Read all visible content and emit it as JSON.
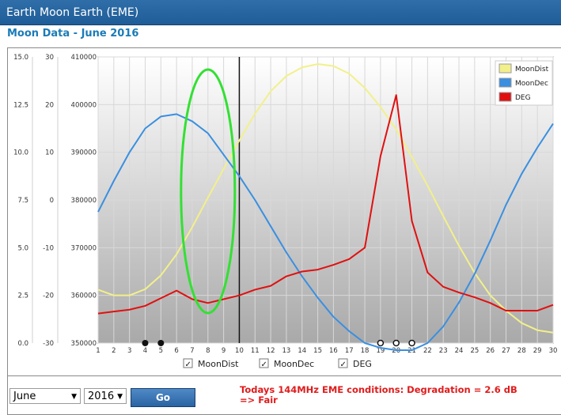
{
  "window": {
    "title": "Earth Moon Earth (EME)"
  },
  "page": {
    "subtitle": "Moon Data - June 2016"
  },
  "controls": {
    "month": "June",
    "year": "2016",
    "go_label": "Go",
    "conditions_line1": "Todays 144MHz EME conditions: Degradation = 2.6 dB",
    "conditions_line2": "=> Fair"
  },
  "legend_checks": [
    {
      "label": "MoonDist",
      "checked": true
    },
    {
      "label": "MoonDec",
      "checked": true
    },
    {
      "label": "DEG",
      "checked": true
    }
  ],
  "chart_data": {
    "type": "line",
    "x": [
      1,
      2,
      3,
      4,
      5,
      6,
      7,
      8,
      9,
      10,
      11,
      12,
      13,
      14,
      15,
      16,
      17,
      18,
      19,
      20,
      21,
      22,
      23,
      24,
      25,
      26,
      27,
      28,
      29,
      30
    ],
    "xlim": [
      1,
      30
    ],
    "axes": {
      "deg": {
        "ticks": [
          "0.0",
          "2.5",
          "5.0",
          "7.5",
          "10.0",
          "12.5",
          "15.0"
        ],
        "ylim": [
          0,
          15
        ]
      },
      "dec": {
        "ticks": [
          "-30",
          "-20",
          "-10",
          "0",
          "10",
          "20",
          "30"
        ],
        "ylim": [
          -30,
          30
        ]
      },
      "dist": {
        "ticks": [
          "350000",
          "360000",
          "370000",
          "380000",
          "390000",
          "400000",
          "410000"
        ],
        "ylim": [
          350000,
          410000
        ]
      }
    },
    "series": [
      {
        "name": "MoonDist",
        "axis": "dist",
        "color": "#f2f08a",
        "values": [
          361200,
          360000,
          360000,
          361300,
          364200,
          368600,
          374300,
          380500,
          386500,
          392500,
          398100,
          402800,
          406000,
          407800,
          408500,
          408100,
          406500,
          403500,
          399500,
          394800,
          389000,
          383000,
          376600,
          370400,
          364700,
          360000,
          356800,
          354200,
          352700,
          352200
        ]
      },
      {
        "name": "MoonDec",
        "axis": "dec",
        "color": "#3a8fe0",
        "values": [
          -2.5,
          4,
          10,
          15,
          17.5,
          18,
          16.5,
          14,
          9.5,
          5,
          0,
          -5.5,
          -11,
          -16,
          -20.5,
          -24.5,
          -27.5,
          -30,
          -31,
          -31.5,
          -31.5,
          -30,
          -26.5,
          -21.5,
          -15.5,
          -8.5,
          -1,
          5.5,
          11,
          16
        ]
      },
      {
        "name": "DEG",
        "axis": "deg",
        "color": "#e01010",
        "values": [
          1.55,
          1.65,
          1.75,
          1.95,
          2.35,
          2.75,
          2.3,
          2.1,
          2.3,
          2.5,
          2.8,
          3.0,
          3.5,
          3.75,
          3.85,
          4.1,
          4.4,
          5.0,
          9.8,
          13.0,
          6.4,
          3.7,
          2.95,
          2.65,
          2.4,
          2.1,
          1.7,
          1.7,
          1.7,
          2.0
        ]
      }
    ],
    "legend": {
      "entries": [
        "MoonDist",
        "MoonDec",
        "DEG"
      ],
      "placement": "top-right"
    },
    "current_day": 10,
    "highlight_day": 8,
    "markers_filled": [
      4,
      5
    ],
    "markers_open": [
      19,
      20,
      21
    ],
    "grid": true
  }
}
